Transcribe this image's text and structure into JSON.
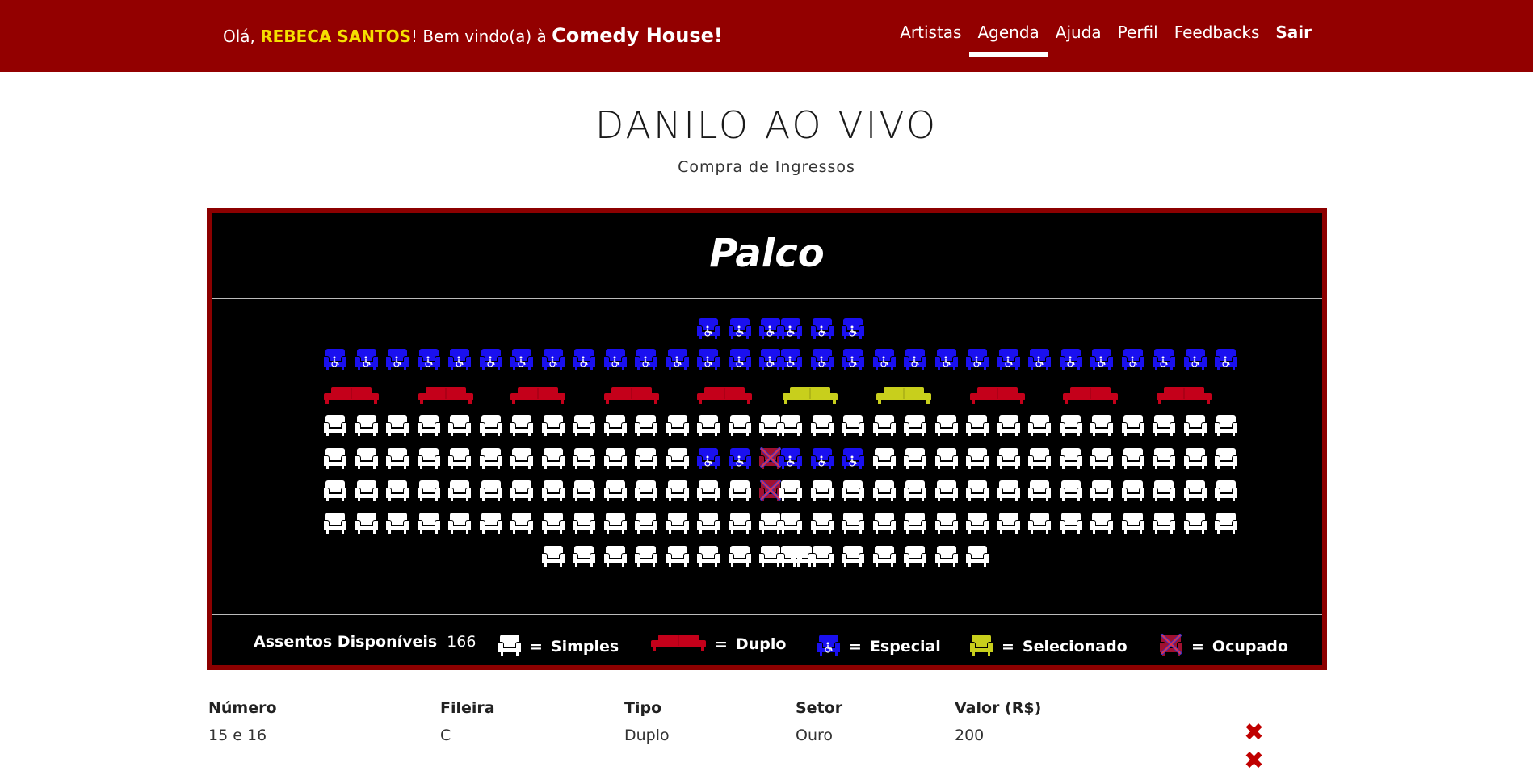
{
  "header": {
    "greeting_prefix": "Olá,",
    "user_name": "REBECA SANTOS",
    "greeting_mid": "! Bem vindo(a) à",
    "house_name": "Comedy House!",
    "nav": [
      {
        "label": "Artistas",
        "active": false
      },
      {
        "label": "Agenda",
        "active": true
      },
      {
        "label": "Ajuda",
        "active": false
      },
      {
        "label": "Perfil",
        "active": false
      },
      {
        "label": "Feedbacks",
        "active": false
      },
      {
        "label": "Sair",
        "active": false
      }
    ]
  },
  "page": {
    "title": "DANILO AO VIVO",
    "subtitle": "Compra de Ingressos"
  },
  "stage": {
    "label": "Palco"
  },
  "colors": {
    "simple": "#ffffff",
    "double": "#c4001a",
    "special": "#1a10f0",
    "selected": "#c8cf1c",
    "occupied": "#7a1030",
    "brand": "#930000"
  },
  "legend": {
    "available_label": "Assentos Disponíveis",
    "available_count": "166",
    "separator": "=",
    "simple": "Simples",
    "double": "Duplo",
    "special": "Especial",
    "selected": "Selecionado",
    "occupied": "Ocupado"
  },
  "seat_rows": [
    {
      "left": "ooooooooooooSSS",
      "right": "SSSoooooooooooo"
    },
    {
      "left": "SSSSSSSSSSSSSSS",
      "right": "SSSSSSSSSSSSSSS"
    },
    {
      "doubles": [
        "d",
        "d",
        "d",
        "d",
        "d",
        "y",
        "y",
        "d",
        "d",
        "d"
      ]
    },
    {
      "left": "sssssssssssssss",
      "right": "sssssssssssssss"
    },
    {
      "left": "ssssssssssssPPX",
      "right": "PPPssssssssssss"
    },
    {
      "left": "ssssssssssssssX",
      "right": "sssssssssssssss"
    },
    {
      "left": "sssssssssssssss",
      "right": "sssssssssssssss"
    },
    {
      "left": "ooooooosssssssss",
      "right": "sssssssoooooooo"
    }
  ],
  "table": {
    "headers": [
      "Número",
      "Fileira",
      "Tipo",
      "Setor",
      "Valor (R$)"
    ],
    "rows": [
      [
        "15 e 16",
        "C",
        "Duplo",
        "Ouro",
        "200"
      ]
    ],
    "remove_symbol": "✖"
  }
}
